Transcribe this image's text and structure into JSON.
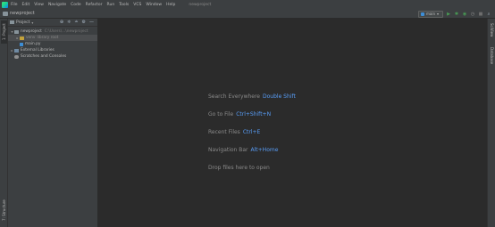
{
  "menubar": {
    "items": [
      "File",
      "Edit",
      "View",
      "Navigate",
      "Code",
      "Refactor",
      "Run",
      "Tools",
      "VCS",
      "Window",
      "Help"
    ],
    "window_title": "newproject"
  },
  "navbar": {
    "project": "newproject",
    "run_config": "main"
  },
  "left_strip": {
    "project_tab": "1: Project",
    "structure_tab": "7: Structure"
  },
  "right_strip": {
    "sciview_tab": "SciView",
    "database_tab": "Database"
  },
  "project_panel": {
    "title": "Project",
    "tree": [
      {
        "label": "newproject",
        "path": "C:\\Users\\...\\newproject",
        "kind": "root"
      },
      {
        "label": "venv",
        "tag": "library root",
        "kind": "venv"
      },
      {
        "label": "main.py",
        "kind": "py"
      },
      {
        "label": "External Libraries",
        "kind": "lib"
      },
      {
        "label": "Scratches and Consoles",
        "kind": "scratch"
      }
    ]
  },
  "editor_hints": [
    {
      "text": "Search Everywhere",
      "key": "Double Shift"
    },
    {
      "text": "Go to File",
      "key": "Ctrl+Shift+N"
    },
    {
      "text": "Recent Files",
      "key": "Ctrl+E"
    },
    {
      "text": "Navigation Bar",
      "key": "Alt+Home"
    },
    {
      "text": "Drop files here to open",
      "key": ""
    }
  ],
  "colors": {
    "background": "#2b2b2b",
    "panel": "#3c3f41",
    "accent": "#589df6"
  }
}
